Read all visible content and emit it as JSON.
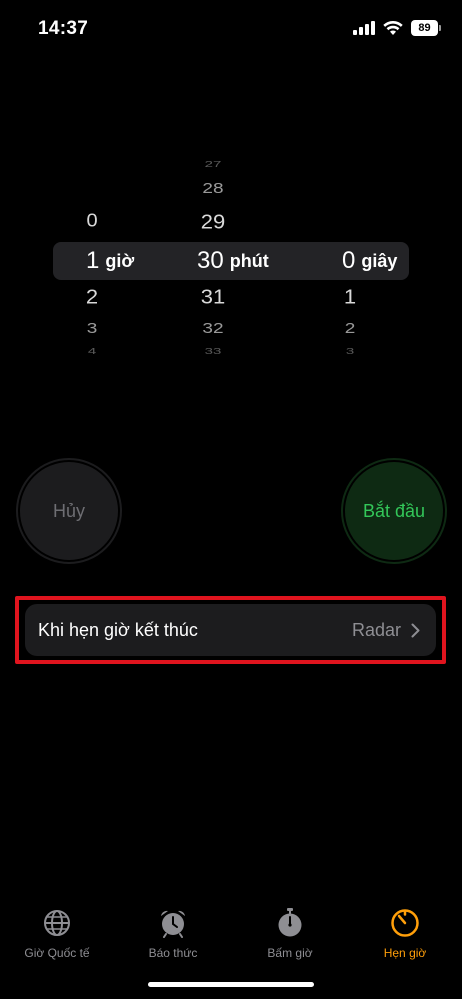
{
  "status_bar": {
    "time": "14:37",
    "battery": "89"
  },
  "picker": {
    "hours": {
      "above": [
        "0"
      ],
      "selected": "1",
      "below": [
        "2",
        "3",
        "4"
      ],
      "unit": "giờ"
    },
    "minutes": {
      "above": [
        "27",
        "28",
        "29"
      ],
      "selected": "30",
      "below": [
        "31",
        "32",
        "33"
      ],
      "unit": "phút"
    },
    "seconds": {
      "above": [],
      "selected": "0",
      "below": [
        "1",
        "2",
        "3"
      ],
      "unit": "giây"
    }
  },
  "buttons": {
    "cancel_label": "Hủy",
    "start_label": "Bắt đầu"
  },
  "when_ends": {
    "label": "Khi hẹn giờ kết thúc",
    "value": "Radar"
  },
  "tabs": [
    {
      "label": "Giờ Quốc tế",
      "icon": "globe-icon",
      "active": false
    },
    {
      "label": "Báo thức",
      "icon": "alarm-clock-icon",
      "active": false
    },
    {
      "label": "Bấm giờ",
      "icon": "stopwatch-icon",
      "active": false
    },
    {
      "label": "Hẹn giờ",
      "icon": "timer-icon",
      "active": true
    }
  ],
  "colors": {
    "accent": "#ff9f0a",
    "start_green": "#33c759",
    "highlight_red": "#e0141e"
  }
}
